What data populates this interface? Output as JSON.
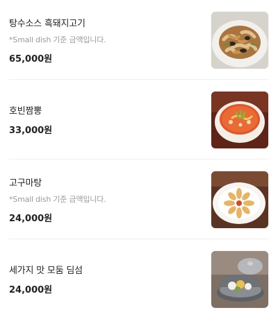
{
  "menu": {
    "items": [
      {
        "name": "탕수소스 흑돼지고기",
        "note": "*Small dish 기준 금액입니다.",
        "price": "65,000원",
        "image": "stir-fried-pork-dish"
      },
      {
        "name": "호빈짬뽕",
        "note": "",
        "price": "33,000원",
        "image": "jjamppong-noodle-soup"
      },
      {
        "name": "고구마탕",
        "note": "*Small dish 기준 금액입니다.",
        "price": "24,000원",
        "image": "sweet-potato-dish"
      },
      {
        "name": "세가지 맛 모둠 딤섬",
        "note": "",
        "price": "24,000원",
        "image": "dim-sum-steamer"
      }
    ]
  }
}
